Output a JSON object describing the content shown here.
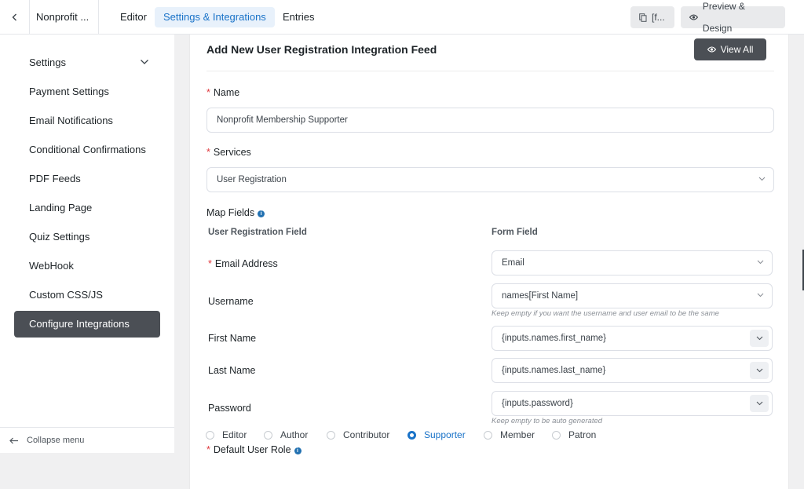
{
  "topbar": {
    "form_title": "Nonprofit ...",
    "tabs": [
      {
        "label": "Editor"
      },
      {
        "label": "Settings & Integrations"
      },
      {
        "label": "Entries"
      }
    ],
    "shortcode_label": "[f...",
    "preview_label": "Preview & Design"
  },
  "sidebar": {
    "items": [
      {
        "label": "Settings"
      },
      {
        "label": "Payment Settings"
      },
      {
        "label": "Email Notifications"
      },
      {
        "label": "Conditional Confirmations"
      },
      {
        "label": "PDF Feeds"
      },
      {
        "label": "Landing Page"
      },
      {
        "label": "Quiz Settings"
      },
      {
        "label": "WebHook"
      },
      {
        "label": "Custom CSS/JS"
      },
      {
        "label": "Configure Integrations"
      }
    ],
    "collapse_label": "Collapse menu"
  },
  "main": {
    "title": "Add New User Registration Integration Feed",
    "view_all_label": "View All",
    "name_label": "Name",
    "name_value": "Nonprofit Membership Supporter",
    "services_label": "Services",
    "services_value": "User Registration",
    "map_fields_label": "Map Fields",
    "col_left": "User Registration Field",
    "col_right": "Form Field",
    "fields": [
      {
        "label": "Email Address",
        "value": "Email"
      },
      {
        "label": "Username",
        "value": "names[First Name]",
        "hint": "Keep empty if you want the username and user email to be the same"
      },
      {
        "label": "First Name",
        "value": "{inputs.names.first_name}"
      },
      {
        "label": "Last Name",
        "value": "{inputs.names.last_name}"
      },
      {
        "label": "Password",
        "value": "{inputs.password}",
        "hint": "Keep empty to be auto generated"
      }
    ],
    "role_label": "Default User Role",
    "roles": [
      {
        "label": "Editor"
      },
      {
        "label": "Author"
      },
      {
        "label": "Contributor"
      },
      {
        "label": "Supporter"
      },
      {
        "label": "Member"
      },
      {
        "label": "Patron"
      }
    ],
    "selected_role": "Supporter"
  },
  "colors": {
    "accent": "#1a73c8",
    "dark_button": "#4b4f55",
    "required": "#e0393e"
  }
}
